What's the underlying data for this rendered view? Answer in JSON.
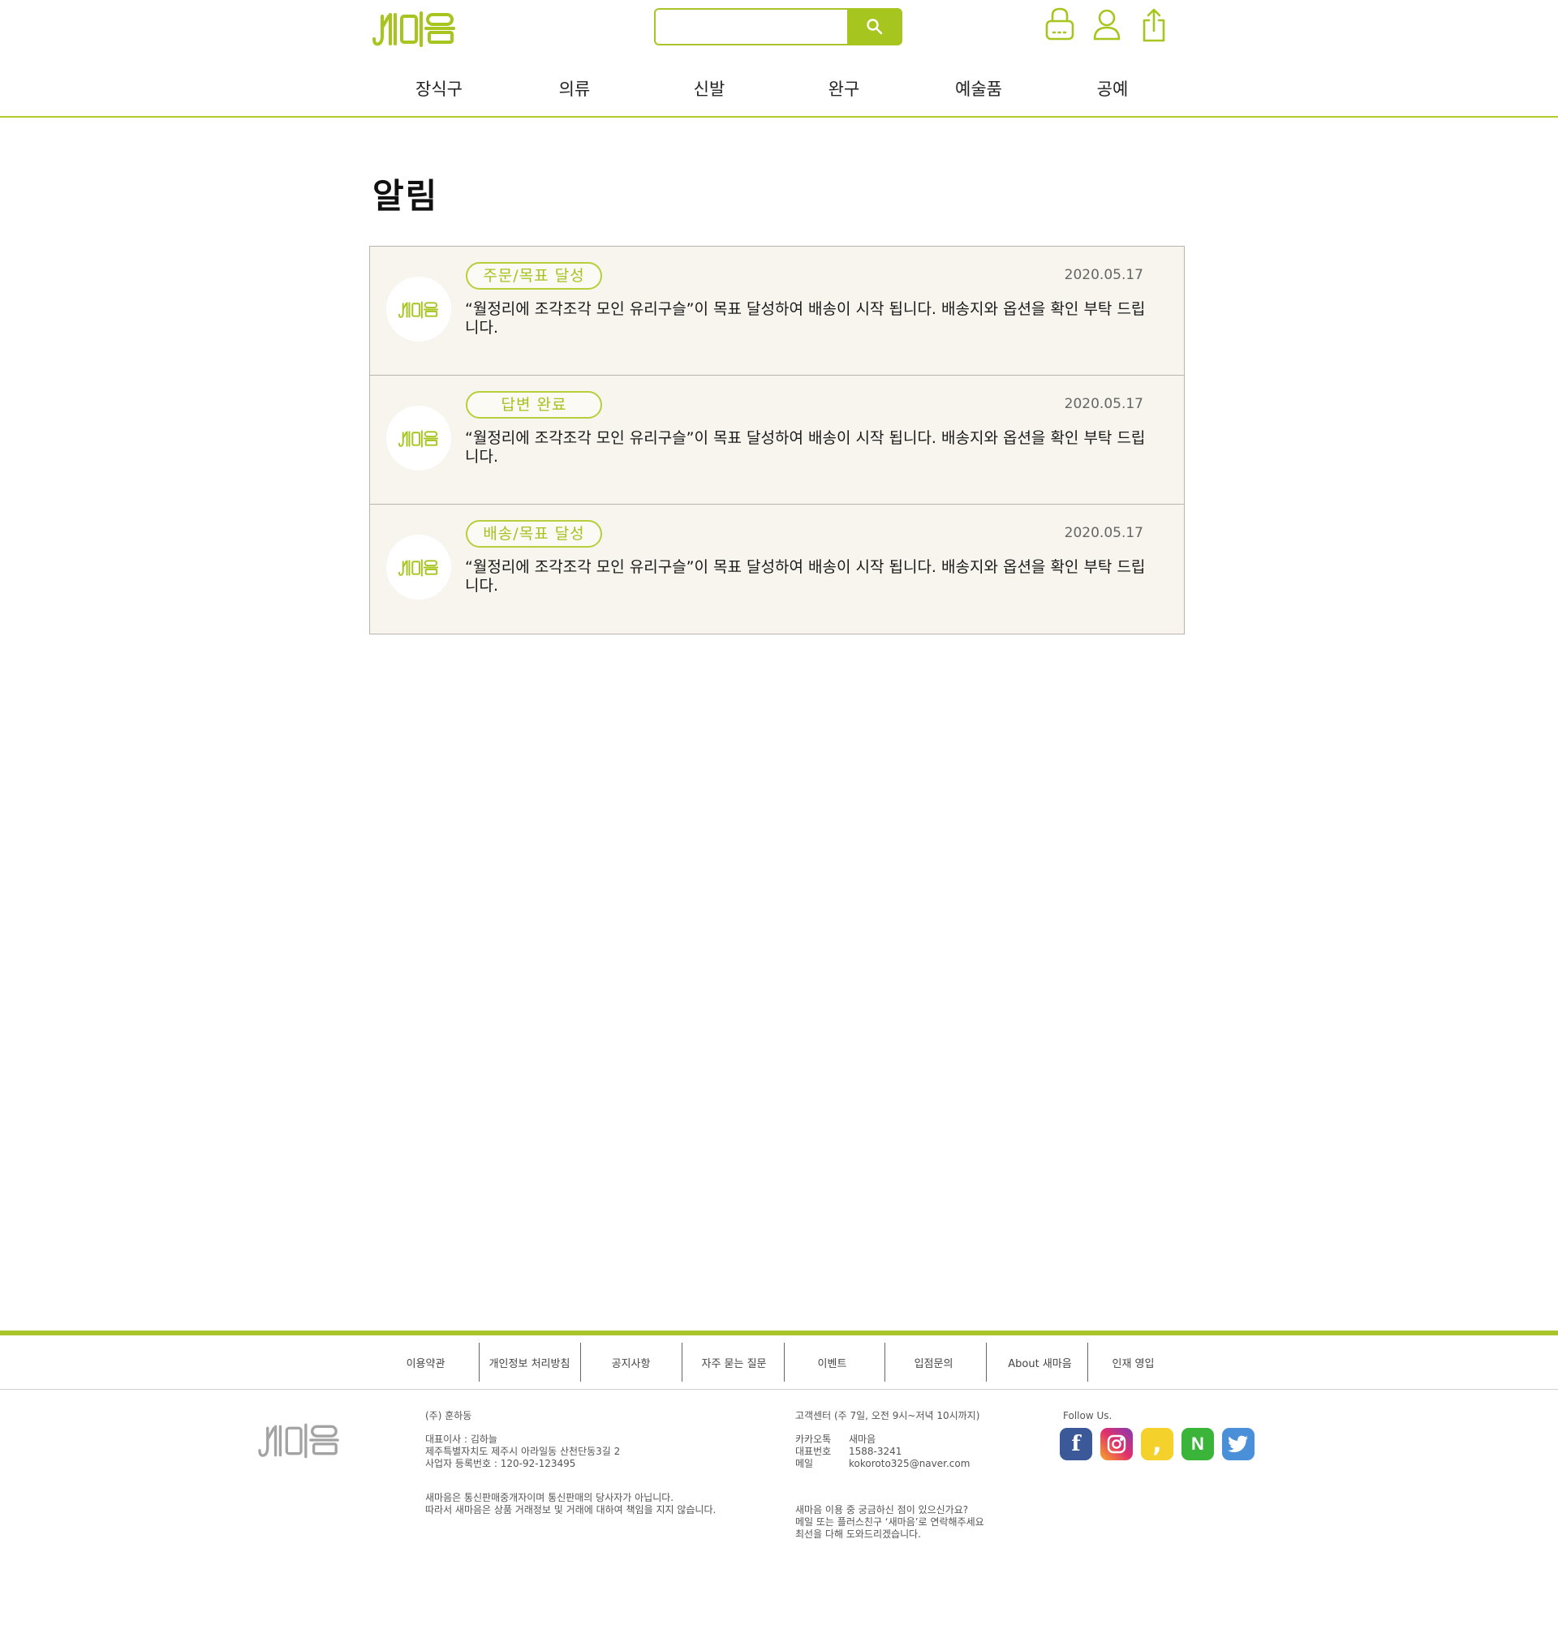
{
  "brand": {
    "name": "새마음",
    "accent": "#a6c51e"
  },
  "search": {
    "placeholder": "",
    "value": ""
  },
  "header_icons": [
    "cart-icon",
    "user-icon",
    "share-icon"
  ],
  "nav": [
    "장식구",
    "의류",
    "신발",
    "완구",
    "예술품",
    "공예"
  ],
  "page_title": "알림",
  "notices": [
    {
      "tag": "주문/목표 달성",
      "date": "2020.05.17",
      "message": "“월정리에 조각조각 모인 유리구슬”이 목표 달성하여 배송이 시작 됩니다. 배송지와 옵션을 확인 부탁 드립니다."
    },
    {
      "tag": "답변 완료",
      "date": "2020.05.17",
      "message": "“월정리에 조각조각 모인 유리구슬”이 목표 달성하여 배송이 시작 됩니다. 배송지와 옵션을 확인 부탁 드립니다."
    },
    {
      "tag": "배송/목표 달성",
      "date": "2020.05.17",
      "message": "“월정리에 조각조각 모인 유리구슬”이 목표 달성하여 배송이 시작 됩니다. 배송지와 옵션을 확인 부탁 드립니다."
    }
  ],
  "footer": {
    "links": [
      "이용약관",
      "개인정보 처리방침",
      "공지사항",
      "자주 묻는 질문",
      "이벤트",
      "입점문의",
      "About 새마음",
      "인재 영입"
    ],
    "company": {
      "name": "(주) 훈하동",
      "ceo": "대표이사 : 김하늘",
      "address": "제주특별자치도 제주시 아라일동 산천단동3길 2",
      "biz_no": "사업자 등록번호 : 120-92-123495",
      "disclaimer_1": "새마음은 통신판매중개자이며 통신판매의 당사자가 아닙니다.",
      "disclaimer_2": "따라서 새마음은 상품 거래정보 및 거래에 대하여 책임을 지지 않습니다."
    },
    "cs": {
      "title": "고객센터 (주 7일, 오전 9시~저녁 10시까지)",
      "kakao_label": "카카오톡",
      "kakao_value": "새마음",
      "phone_label": "대표번호",
      "phone_value": "1588-3241",
      "mail_label": "메일",
      "mail_value": "kokoroto325@naver.com",
      "help_1": "새마음 이용 중 궁금하신 점이 있으신가요?",
      "help_2": "메일 또는 플러스친구 ‘새마음’로 연락해주세요",
      "help_3": "최선을 다해 도와드리겠습니다."
    },
    "follow_label": "Follow Us.",
    "social": [
      {
        "icon": "facebook-icon",
        "color": "#3b5998"
      },
      {
        "icon": "instagram-icon",
        "color": "#c13584"
      },
      {
        "icon": "kakaostory-icon",
        "color": "#f5d12b"
      },
      {
        "icon": "naver-icon",
        "color": "#3ab53a"
      },
      {
        "icon": "twitter-icon",
        "color": "#4a90d9"
      }
    ]
  }
}
